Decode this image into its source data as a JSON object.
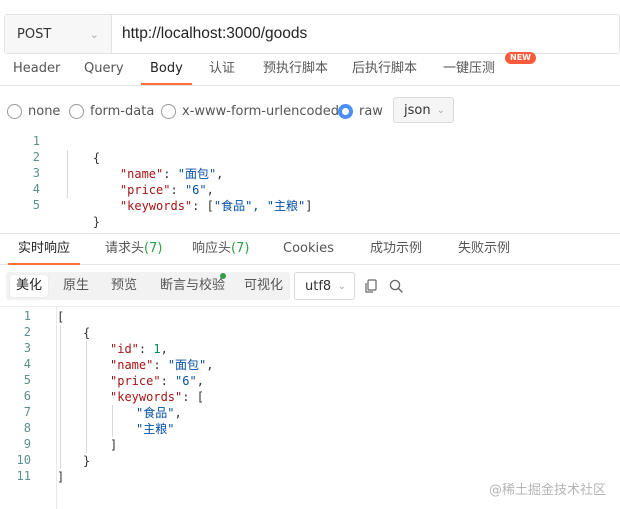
{
  "request": {
    "method": "POST",
    "url": "http://localhost:3000/goods"
  },
  "req_tabs": [
    {
      "label": "Header"
    },
    {
      "label": "Query"
    },
    {
      "label": "Body"
    },
    {
      "label": "认证"
    },
    {
      "label": "预执行脚本"
    },
    {
      "label": "后执行脚本"
    },
    {
      "label": "一键压测"
    }
  ],
  "new_badge": "NEW",
  "body_types": [
    {
      "label": "none"
    },
    {
      "label": "form-data"
    },
    {
      "label": "x-www-form-urlencoded"
    },
    {
      "label": "raw"
    }
  ],
  "body_format": "json",
  "request_body": {
    "line_numbers": [
      "1",
      "2",
      "3",
      "4",
      "5"
    ],
    "lines": [
      [
        "{",
        "",
        "",
        ""
      ],
      [
        "\"name\"",
        ": ",
        "\"面包\"",
        ","
      ],
      [
        "\"price\"",
        ": ",
        "\"6\"",
        ","
      ],
      [
        "\"keywords\"",
        ": [",
        "\"食品\", \"主粮\"",
        "]"
      ],
      [
        "}",
        "",
        "",
        ""
      ]
    ]
  },
  "resp_tabs": [
    {
      "label": "实时响应",
      "count": ""
    },
    {
      "label": "请求头",
      "count": "(7)"
    },
    {
      "label": "响应头",
      "count": "(7)"
    },
    {
      "label": "Cookies",
      "count": ""
    },
    {
      "label": "成功示例",
      "count": ""
    },
    {
      "label": "失败示例",
      "count": ""
    }
  ],
  "view_modes": [
    {
      "label": "美化"
    },
    {
      "label": "原生"
    },
    {
      "label": "预览"
    },
    {
      "label": "断言与校验"
    },
    {
      "label": "可视化"
    }
  ],
  "encoding": "utf8",
  "icons": {
    "copy": "copy-icon",
    "search": "search-icon"
  },
  "response_body": {
    "line_numbers": [
      "1",
      "2",
      "3",
      "4",
      "5",
      "6",
      "7",
      "8",
      "9",
      "10",
      "11"
    ],
    "l1": "[",
    "l2": "{",
    "l3_key": "\"id\"",
    "l3_sep": ": ",
    "l3_val": "1",
    "l3_end": ",",
    "l4_key": "\"name\"",
    "l4_sep": ": ",
    "l4_val": "\"面包\"",
    "l4_end": ",",
    "l5_key": "\"price\"",
    "l5_sep": ": ",
    "l5_val": "\"6\"",
    "l5_end": ",",
    "l6_key": "\"keywords\"",
    "l6_sep": ": [",
    "l7_val": "\"食品\"",
    "l7_end": ",",
    "l8_val": "\"主粮\"",
    "l9": "]",
    "l10": "}",
    "l11": "]"
  },
  "watermark": "@稀土掘金技术社区",
  "colors": {
    "accent": "#ff6c37",
    "radio": "#4a8ef7",
    "badge": "#ff5a3c",
    "count": "#2ea043"
  }
}
